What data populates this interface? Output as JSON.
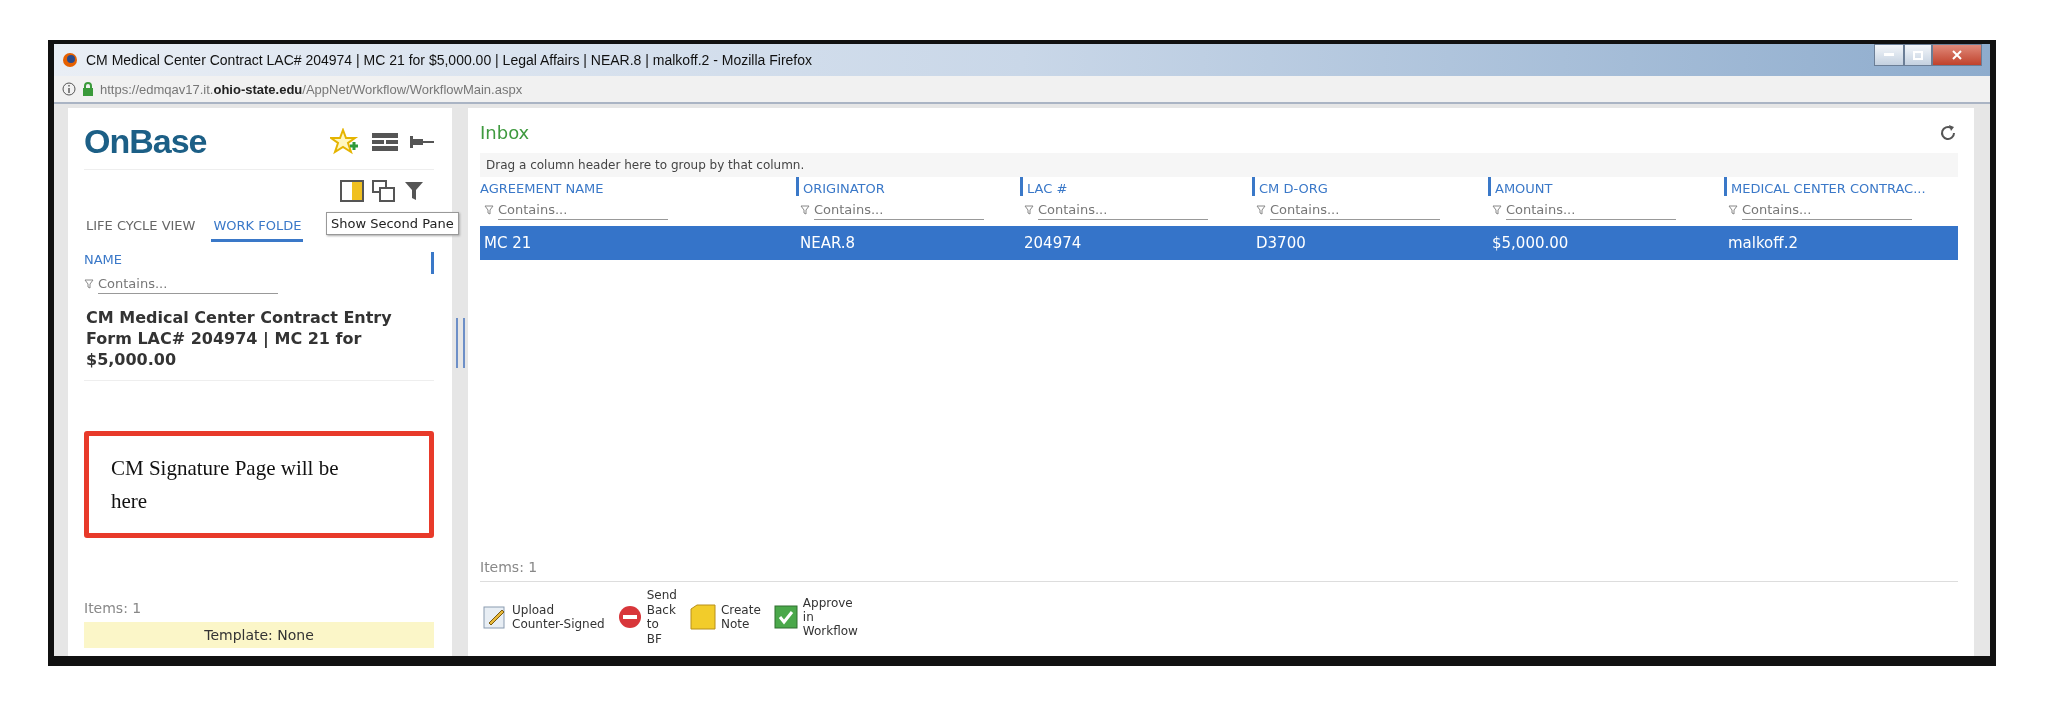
{
  "window": {
    "title": "CM Medical Center Contract LAC# 204974 | MC 21 for $5,000.00 | Legal Affairs | NEAR.8 | malkoff.2 - Mozilla Firefox"
  },
  "address_bar": {
    "url_prefix": "https://edmqav17.it.",
    "url_domain": "ohio-state.edu",
    "url_path": "/AppNet/Workflow/WorkflowMain.aspx"
  },
  "sidebar": {
    "logo": "OnBase",
    "tabs": [
      {
        "label": "LIFE CYCLE VIEW",
        "selected": false
      },
      {
        "label": "WORK FOLDE",
        "selected": true
      }
    ],
    "tooltip": "Show Second Pane",
    "column": "NAME",
    "filter": {
      "placeholder": "Contains..."
    },
    "items": [
      {
        "label": "CM Medical Center Contract Entry Form LAC# 204974 | MC 21 for $5,000.00"
      }
    ],
    "note": "CM Signature Page will be here",
    "count": "Items: 1",
    "template": "Template: None"
  },
  "inbox": {
    "title": "Inbox",
    "group_hint": "Drag a column header here to group by that column.",
    "columns": [
      {
        "label": "AGREEMENT NAME",
        "placeholder": "Contains..."
      },
      {
        "label": "ORIGINATOR",
        "placeholder": "Contains..."
      },
      {
        "label": "LAC #",
        "placeholder": "Contains..."
      },
      {
        "label": "CM D-ORG",
        "placeholder": "Contains..."
      },
      {
        "label": "AMOUNT",
        "placeholder": "Contains..."
      },
      {
        "label": "MEDICAL CENTER CONTRAC...",
        "placeholder": "Contains..."
      }
    ],
    "rows": [
      {
        "selected": true,
        "cells": [
          "MC 21",
          "NEAR.8",
          "204974",
          "D3700",
          "$5,000.00",
          "malkoff.2"
        ]
      }
    ],
    "count": "Items: 1",
    "actions": [
      {
        "kind": "upload",
        "label": "Upload\nCounter-Signed"
      },
      {
        "kind": "sendback",
        "label": "Send\nBack\nto\nBF"
      },
      {
        "kind": "note",
        "label": "Create\nNote"
      },
      {
        "kind": "approve",
        "label": "Approve\nin\nWorkflow"
      }
    ]
  }
}
